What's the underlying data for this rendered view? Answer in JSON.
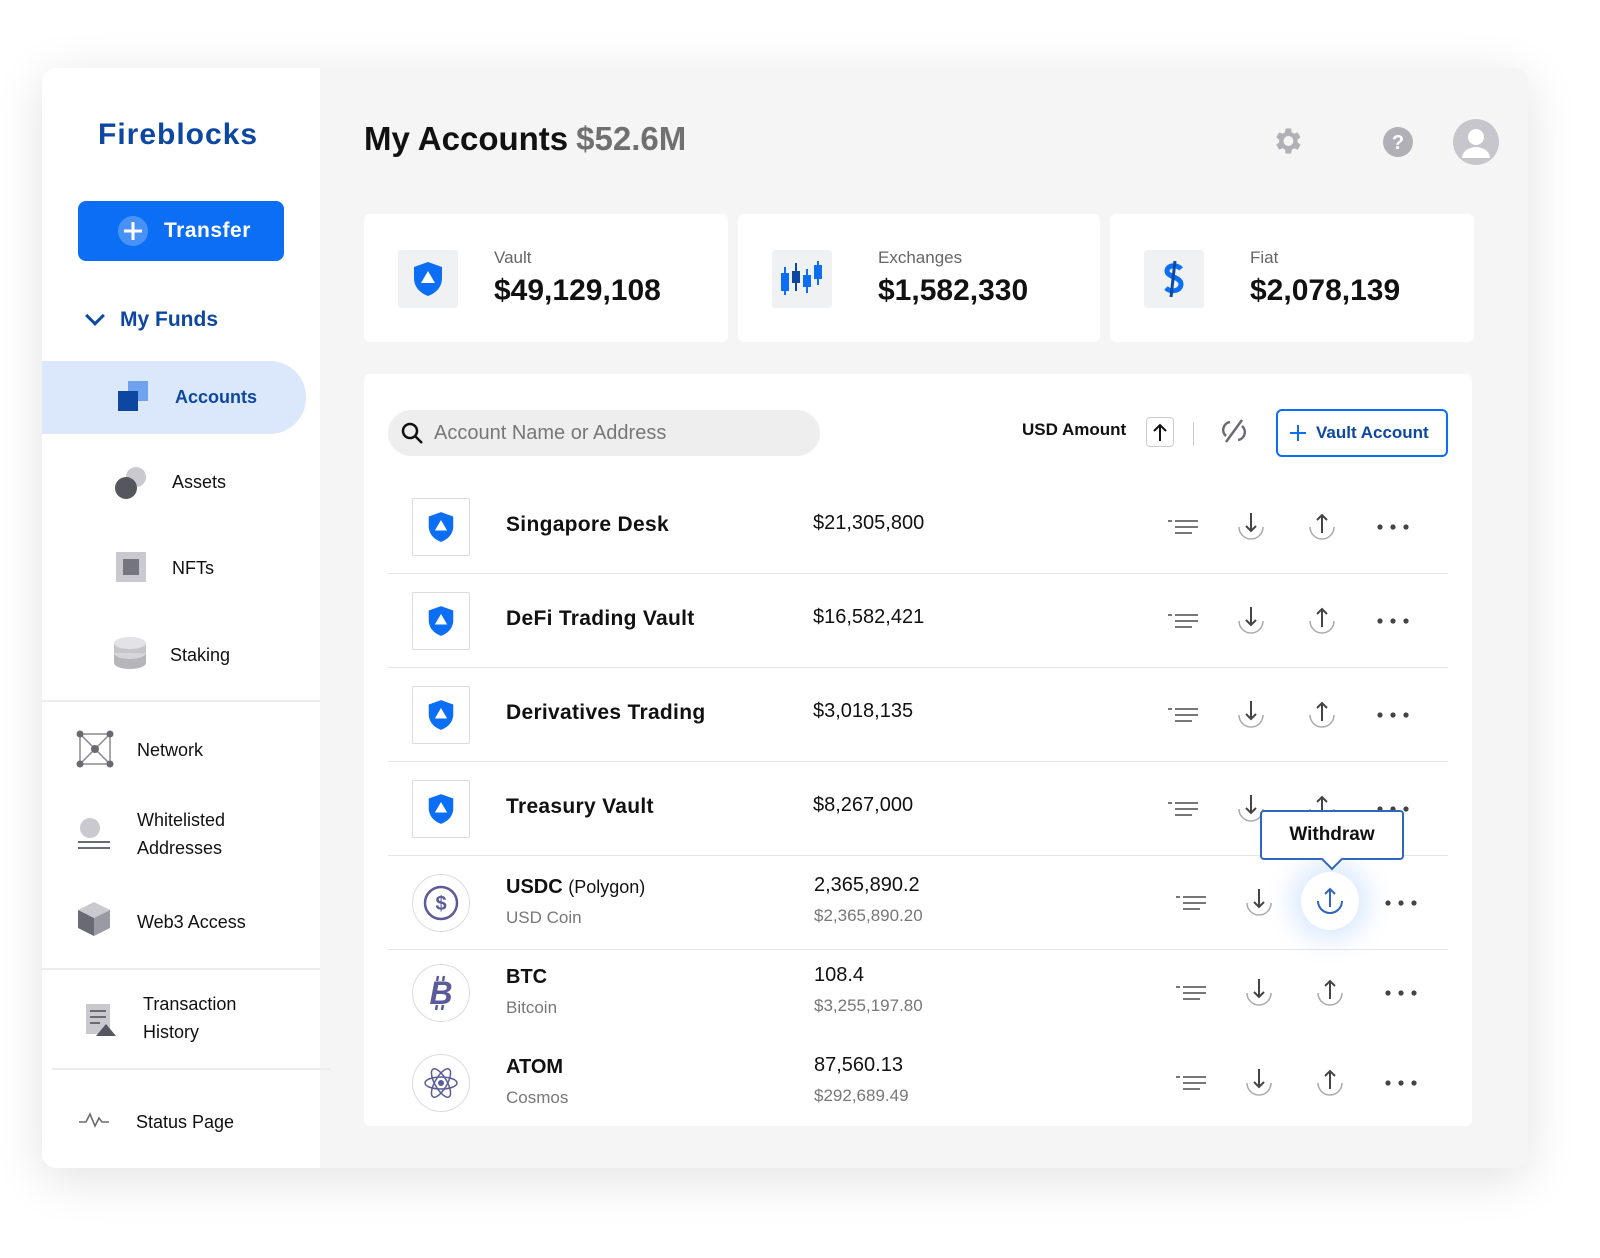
{
  "app": {
    "logo": "Fireblocks"
  },
  "sidebar": {
    "transfer_label": "Transfer",
    "funds_label": "My Funds",
    "items": [
      {
        "label": "Accounts",
        "icon": "accounts-icon"
      },
      {
        "label": "Assets",
        "icon": "assets-icon"
      },
      {
        "label": "NFTs",
        "icon": "nft-icon"
      },
      {
        "label": "Staking",
        "icon": "staking-icon"
      },
      {
        "label": "Network",
        "icon": "network-icon"
      },
      {
        "label": "Whitelisted Addresses",
        "icon": "whitelist-icon"
      },
      {
        "label": "Web3 Access",
        "icon": "web3-cube-icon"
      },
      {
        "label": "Transaction History",
        "icon": "transaction-history-icon"
      },
      {
        "label": "Status Page",
        "icon": "status-pulse-icon"
      }
    ]
  },
  "header": {
    "title": "My Accounts",
    "total": "$52.6M"
  },
  "cards": [
    {
      "label": "Vault",
      "value": "$49,129,108",
      "icon": "vault-shield-icon"
    },
    {
      "label": "Exchanges",
      "value": "$1,582,330",
      "icon": "exchange-candles-icon"
    },
    {
      "label": "Fiat",
      "value": "$2,078,139",
      "icon": "fiat-dollar-icon"
    }
  ],
  "toolbar": {
    "search_placeholder": "Account Name or Address",
    "sort_label": "USD Amount",
    "vault_account_label": "Vault Account"
  },
  "accounts": [
    {
      "name": "Singapore Desk",
      "amount": "$21,305,800"
    },
    {
      "name": "DeFi Trading Vault",
      "amount": "$16,582,421"
    },
    {
      "name": "Derivatives Trading",
      "amount": "$3,018,135"
    },
    {
      "name": "Treasury Vault",
      "amount": "$8,267,000"
    }
  ],
  "assets": [
    {
      "symbol": "USDC",
      "network": "(Polygon)",
      "name": "USD Coin",
      "quantity": "2,365,890.2",
      "usd": "$2,365,890.20"
    },
    {
      "symbol": "BTC",
      "network": "",
      "name": "Bitcoin",
      "quantity": "108.4",
      "usd": "$3,255,197.80"
    },
    {
      "symbol": "ATOM",
      "network": "",
      "name": "Cosmos",
      "quantity": "87,560.13",
      "usd": "$292,689.49"
    }
  ],
  "tooltip": {
    "label": "Withdraw"
  },
  "colors": {
    "brand": "#0b6ef5",
    "brand_dark": "#0d47a1",
    "active_bg": "#dbe8fb"
  }
}
